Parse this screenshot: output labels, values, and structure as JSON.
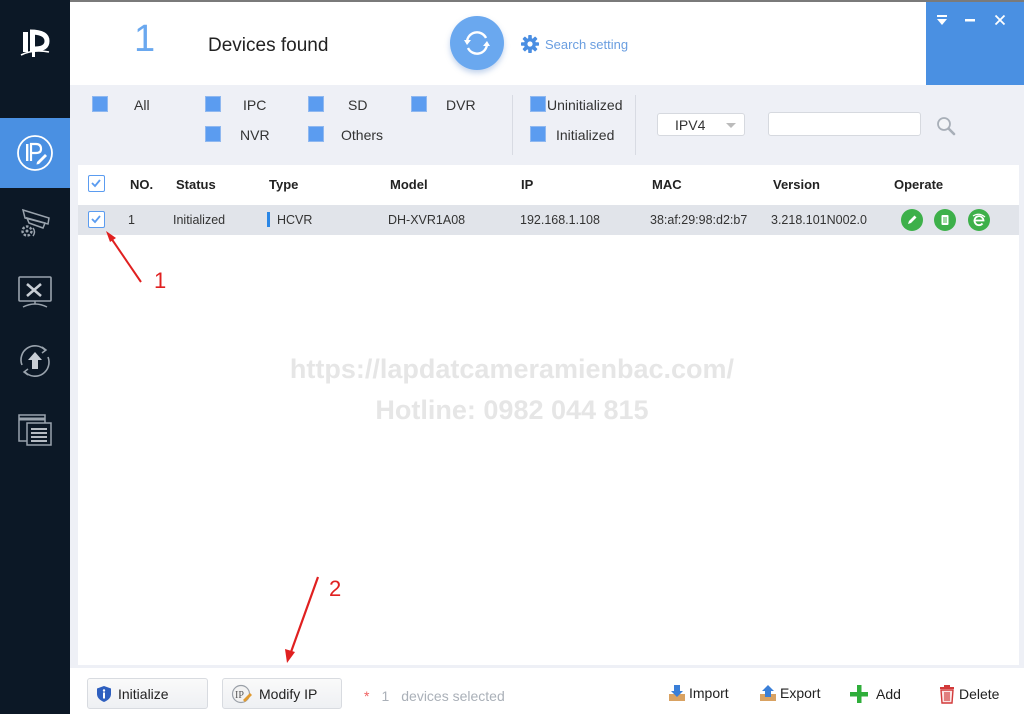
{
  "app": {
    "device_count": "1",
    "devices_found_label": "Devices found",
    "search_setting_label": "Search setting",
    "accent_color": "#4a90e2"
  },
  "window_controls": [
    "dropdown",
    "minimize",
    "close"
  ],
  "sidebar": {
    "items": [
      {
        "id": "ip-modify",
        "icon": "ip-pencil-icon",
        "active": true
      },
      {
        "id": "device-config",
        "icon": "camera-gear-icon",
        "active": false
      },
      {
        "id": "system-settings",
        "icon": "monitor-tools-icon",
        "active": false
      },
      {
        "id": "upgrade",
        "icon": "upgrade-arrow-icon",
        "active": false
      },
      {
        "id": "device-list",
        "icon": "document-windows-icon",
        "active": false
      }
    ]
  },
  "filters": {
    "type": [
      {
        "label": "All",
        "checked": true
      },
      {
        "label": "IPC",
        "checked": true
      },
      {
        "label": "SD",
        "checked": true
      },
      {
        "label": "DVR",
        "checked": true
      },
      {
        "label": "NVR",
        "checked": true
      },
      {
        "label": "Others",
        "checked": true
      }
    ],
    "status": [
      {
        "label": "Uninitialized",
        "checked": true
      },
      {
        "label": "Initialized",
        "checked": true
      }
    ],
    "ip_version": "IPV4",
    "search_value": ""
  },
  "table": {
    "columns": [
      "NO.",
      "Status",
      "Type",
      "Model",
      "IP",
      "MAC",
      "Version",
      "Operate"
    ],
    "rows": [
      {
        "selected": true,
        "no": "1",
        "status": "Initialized",
        "type": "HCVR",
        "model": "DH-XVR1A08",
        "ip": "192.168.1.108",
        "mac": "38:af:29:98:d2:b7",
        "version": "3.218.101N002.0",
        "operations": [
          "edit",
          "details",
          "web"
        ]
      }
    ]
  },
  "watermark": {
    "line1": "https://lapdatcameramienbac.com/",
    "line2": "Hotline: 0982 044 815"
  },
  "annotations": {
    "step1": "1",
    "step2": "2"
  },
  "footer": {
    "initialize_label": "Initialize",
    "modify_ip_label": "Modify IP",
    "selected_star": "*",
    "selected_count": "1",
    "selected_text": "devices selected",
    "import_label": "Import",
    "export_label": "Export",
    "add_label": "Add",
    "delete_label": "Delete"
  }
}
